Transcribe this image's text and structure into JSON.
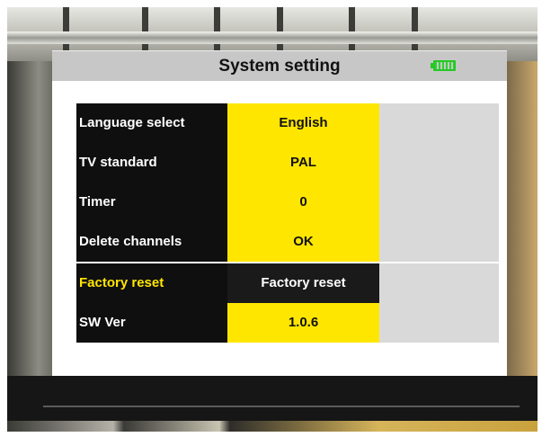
{
  "header": {
    "title": "System setting",
    "battery_icon": "battery-icon"
  },
  "settings": [
    {
      "label": "Language select",
      "value": "English"
    },
    {
      "label": "TV standard",
      "value": "PAL"
    },
    {
      "label": "Timer",
      "value": "0"
    },
    {
      "label": "Delete channels",
      "value": "OK"
    },
    {
      "label": "Factory reset",
      "value": "Factory reset"
    },
    {
      "label": "SW Ver",
      "value": "1.0.6"
    }
  ],
  "colors": {
    "highlight": "#ffe600",
    "label_bg": "#0f0f0f",
    "selected_value_bg": "#1a1a1a",
    "side_panel": "#d9d9d9",
    "battery": "#25c825"
  }
}
